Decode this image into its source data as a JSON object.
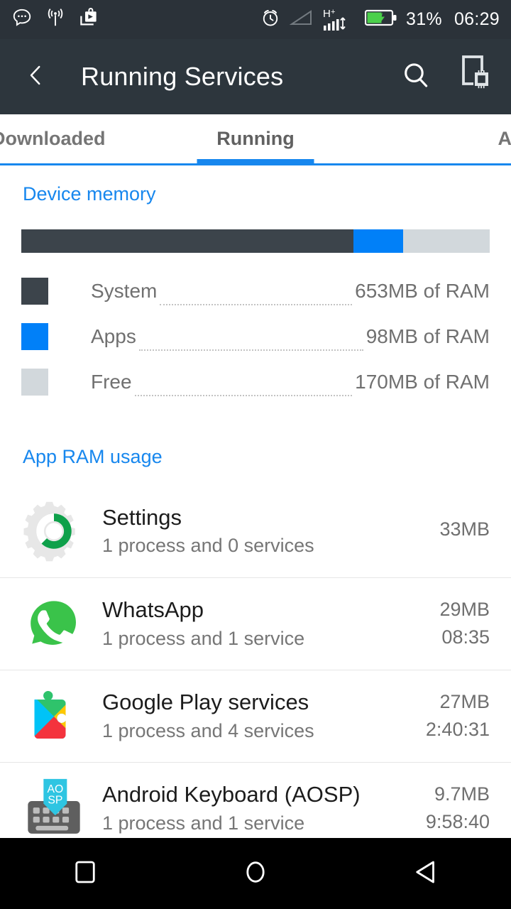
{
  "status_bar": {
    "icons_left": [
      "chat-bubble-icon",
      "wifi-signal-icon",
      "play-store-download-icon"
    ],
    "icons_right": [
      "alarm-clock-icon",
      "signal-triangle-icon",
      "hplus-data-icon",
      "battery-charging-icon"
    ],
    "network_type": "H",
    "network_sup": "+",
    "battery_percent": "31%",
    "clock": "06:29",
    "background": "#2b3239"
  },
  "app_bar": {
    "back_icon": "chevron-left-icon",
    "title": "Running Services",
    "search_icon": "search-icon",
    "device_chip_icon": "device-cpu-icon",
    "background": "#2d363d"
  },
  "tabs": {
    "accent": "#1787ee",
    "items": [
      {
        "label": "Downloaded",
        "active": false
      },
      {
        "label": "Running",
        "active": true
      },
      {
        "label": "All",
        "active": false
      }
    ]
  },
  "device_memory": {
    "title": "Device memory",
    "bar": [
      {
        "name": "System",
        "color": "#3c444b",
        "percent": 70.9
      },
      {
        "name": "Apps",
        "color": "#0180f8",
        "percent": 10.6
      },
      {
        "name": "Free",
        "color": "#d2d8dc",
        "percent": 18.5
      }
    ],
    "legend": [
      {
        "label": "System",
        "value": "653MB of RAM",
        "color": "#3c444b"
      },
      {
        "label": "Apps",
        "value": "98MB of RAM",
        "color": "#0180f8"
      },
      {
        "label": "Free",
        "value": "170MB of RAM",
        "color": "#d2d8dc"
      }
    ]
  },
  "app_ram_usage": {
    "title": "App RAM usage",
    "rows": [
      {
        "icon": "settings-gear-icon",
        "name": "Settings",
        "subtitle": "1 process and 0 services",
        "size": "33MB",
        "time": ""
      },
      {
        "icon": "whatsapp-icon",
        "name": "WhatsApp",
        "subtitle": "1 process and 1 service",
        "size": "29MB",
        "time": "08:35"
      },
      {
        "icon": "google-play-services-icon",
        "name": "Google Play services",
        "subtitle": "1 process and 4 services",
        "size": "27MB",
        "time": "2:40:31"
      },
      {
        "icon": "android-keyboard-aosp-icon",
        "name": "Android Keyboard (AOSP)",
        "subtitle": "1 process and 1 service",
        "size": "9.7MB",
        "time": "9:58:40"
      }
    ]
  },
  "nav_bar": {
    "buttons": [
      "recents-square-icon",
      "home-circle-icon",
      "back-triangle-icon"
    ],
    "background": "#000000"
  }
}
